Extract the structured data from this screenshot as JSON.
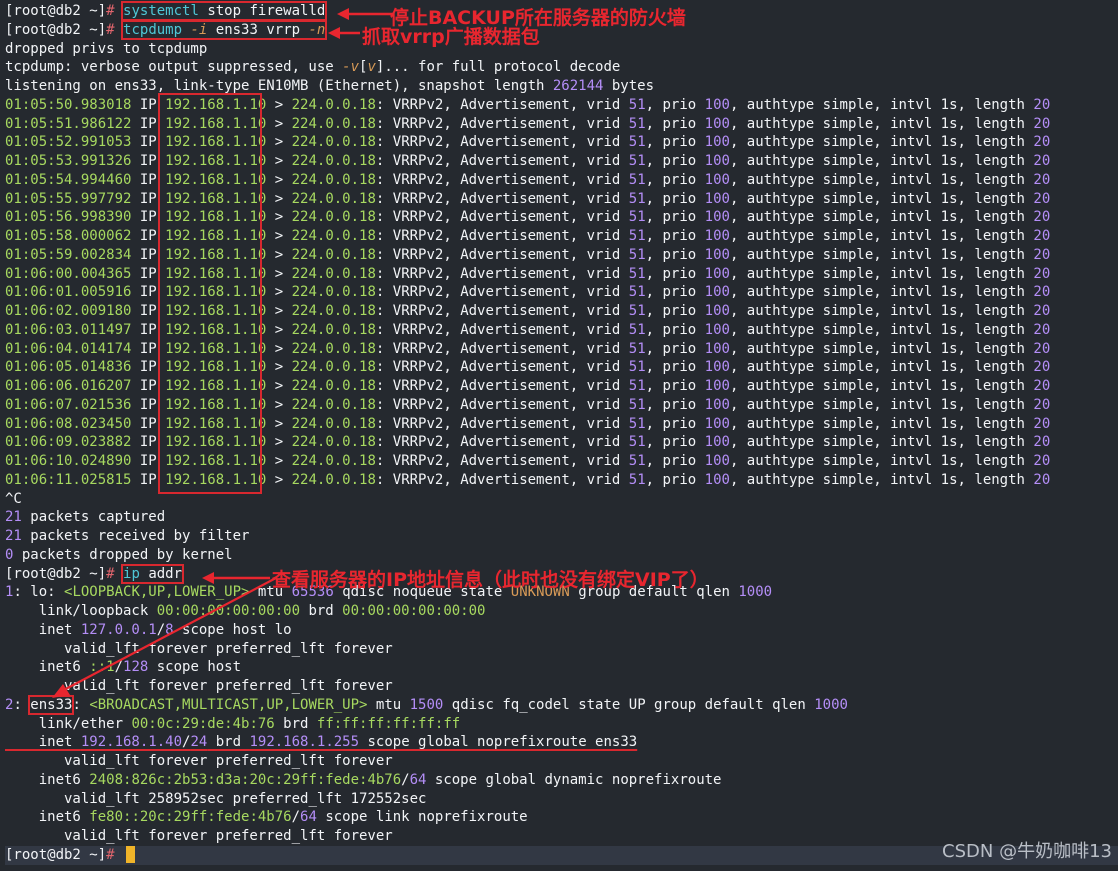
{
  "prompt": "[root@db2 ~]",
  "prompt_symbol": "#",
  "cmd1": {
    "a": "systemctl",
    "b": " stop firewalld"
  },
  "cmd2": {
    "a": "tcpdump",
    "b": " -i",
    "c": " ens33 vrrp ",
    "d": "-n"
  },
  "msg1": "dropped privs to tcpdump",
  "msg2": {
    "a": "tcpdump: verbose output suppressed, use ",
    "b": "-v",
    "c": "[",
    "d": "v",
    "e": "]... for full protocol decode"
  },
  "msg3": {
    "a": "listening on ens33, link-type EN10MB (Ethernet), snapshot length ",
    "b": "262144",
    "c": " bytes"
  },
  "packet": {
    "ip_label": " IP ",
    "src": "192.168.1.10",
    "arrow": " > ",
    "dst": "224.0.0.18",
    "colon": ": ",
    "desc": "VRRPv2, Advertisement, vrid ",
    "vrid": "51",
    "prio_label": ", prio ",
    "prio": "100",
    "auth": ", authtype simple, intvl 1s, length ",
    "length": "20"
  },
  "packets": [
    "01:05:50.983018",
    "01:05:51.986122",
    "01:05:52.991053",
    "01:05:53.991326",
    "01:05:54.994460",
    "01:05:55.997792",
    "01:05:56.998390",
    "01:05:58.000062",
    "01:05:59.002834",
    "01:06:00.004365",
    "01:06:01.005916",
    "01:06:02.009180",
    "01:06:03.011497",
    "01:06:04.014174",
    "01:06:05.014836",
    "01:06:06.016207",
    "01:06:07.021536",
    "01:06:08.023450",
    "01:06:09.023882",
    "01:06:10.024890",
    "01:06:11.025815"
  ],
  "ctrl_c": "^C",
  "summary": {
    "captured_n": "21",
    "captured": " packets captured",
    "received_n": "21",
    "received": " packets received by filter",
    "dropped_n": "0",
    "dropped": " packets dropped by kernel"
  },
  "cmd3": {
    "a": "ip",
    "b": " addr"
  },
  "lo": {
    "num": "1",
    "name": ": lo: ",
    "flags": "<LOOPBACK,UP,LOWER_UP>",
    "mtu_label": " mtu ",
    "mtu": "65536",
    "qdisc": " qdisc noqueue state ",
    "state": "UNKNOWN",
    "group": " group default qlen ",
    "qlen": "1000",
    "link_label": "    link/loopback ",
    "link_mac": "00:00:00:00:00:00",
    "brd": " brd ",
    "brd_mac": "00:00:00:00:00:00",
    "inet_label": "    inet ",
    "inet": "127.0.0.1",
    "inet_slash": "/",
    "inet_prefix": "8",
    "inet_rest": " scope host lo",
    "valid": "       valid_lft forever preferred_lft forever",
    "inet6_label": "    inet6 ",
    "inet6": "::1",
    "inet6_slash": "/",
    "inet6_prefix": "128",
    "inet6_rest": " scope host",
    "valid2": "       valid_lft forever preferred_lft forever"
  },
  "ens": {
    "num": "2",
    "colon": ": ",
    "name": "ens33",
    "colon2": ": ",
    "flags": "<BROADCAST,MULTICAST,UP,LOWER_UP>",
    "mtu_label": " mtu ",
    "mtu": "1500",
    "qdisc": " qdisc fq_codel state UP group default qlen ",
    "qlen": "1000",
    "link_label": "    link/ether ",
    "link_mac": "00:0c:29:de:4b:76",
    "brd": " brd ",
    "brd_mac": "ff:ff:ff:ff:ff:ff",
    "inet_label": "    inet ",
    "inet": "192.168.1.40",
    "inet_slash": "/",
    "inet_prefix": "24",
    "inet_brd": " brd ",
    "inet_brd_ip": "192.168.1.255",
    "inet_rest": " scope global noprefixroute ens33",
    "valid": "       valid_lft forever preferred_lft forever",
    "inet6_label": "    inet6 ",
    "inet6": "2408:826c:2b53:d3a:20c:29ff:fede:4b76",
    "inet6_slash": "/",
    "inet6_prefix": "64",
    "inet6_rest": " scope global dynamic noprefixroute",
    "valid2_a": "       valid_lft ",
    "valid2_b": "258952sec",
    "valid2_c": " preferred_lft ",
    "valid2_d": "172552sec",
    "inet6b_label": "    inet6 ",
    "inet6b": "fe80::20c:29ff:fede:4b76",
    "inet6b_slash": "/",
    "inet6b_prefix": "64",
    "inet6b_rest": " scope link noprefixroute",
    "valid3": "       valid_lft forever preferred_lft forever"
  },
  "annotations": {
    "a1": "停止BACKUP所在服务器的防火墙",
    "a2": "抓取vrrp广播数据包",
    "a3": "查看服务器的IP地址信息（此时也没有绑定VIP了）"
  },
  "watermark": "CSDN @牛奶咖啡13",
  "colors": {
    "annotation": "#e8262f",
    "box": "#d8282f",
    "cursor": "#f0b429",
    "background": "#25292f"
  }
}
